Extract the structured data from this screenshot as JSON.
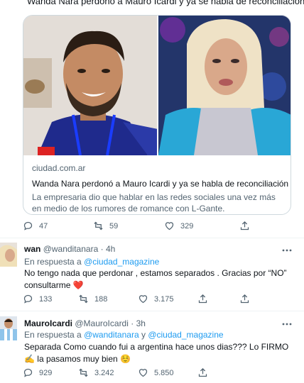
{
  "quoted_headline": "Wanda Nara perdonó a Mauro Icardi y ya se habla de reconciliación",
  "link_card": {
    "domain": "ciudad.com.ar",
    "title": "Wanda Nara perdonó a Mauro Icardi y ya se habla de reconciliación",
    "description": "La empresaria dio que hablar en las redes sociales una vez más en medio de los rumores de romance con L-Gante."
  },
  "main_actions": {
    "replies": "47",
    "retweets": "59",
    "likes": "329"
  },
  "replies": [
    {
      "name": "wan",
      "handle": "@wanditanara",
      "separator": "·",
      "time": "4h",
      "in_reply_prefix": "En respuesta a",
      "in_reply_mentions": "@ciudad_magazine",
      "in_reply_and": "",
      "in_reply_mention2": "",
      "text": "No tengo nada que perdonar , estamos separados . Gracias por “NO” consultarme",
      "emoji": "❤️",
      "actions": {
        "replies": "133",
        "retweets": "188",
        "likes": "3.175"
      }
    },
    {
      "name": "MauroIcardi",
      "handle": "@MauroIcardi",
      "separator": "·",
      "time": "3h",
      "in_reply_prefix": "En respuesta a",
      "in_reply_mentions": "@wanditanara",
      "in_reply_and": "y",
      "in_reply_mention2": "@ciudad_magazine",
      "text": "Separada Como cuando fui a argentina hace unos dias??? Lo FIRMO ✍️ la pasamos muy bien ☺️",
      "actions": {
        "replies": "929",
        "retweets": "3.242",
        "likes": "5.850"
      }
    }
  ],
  "colors": {
    "link": "#1d9bf0",
    "secondary": "#536471",
    "heart": "#f91880"
  }
}
